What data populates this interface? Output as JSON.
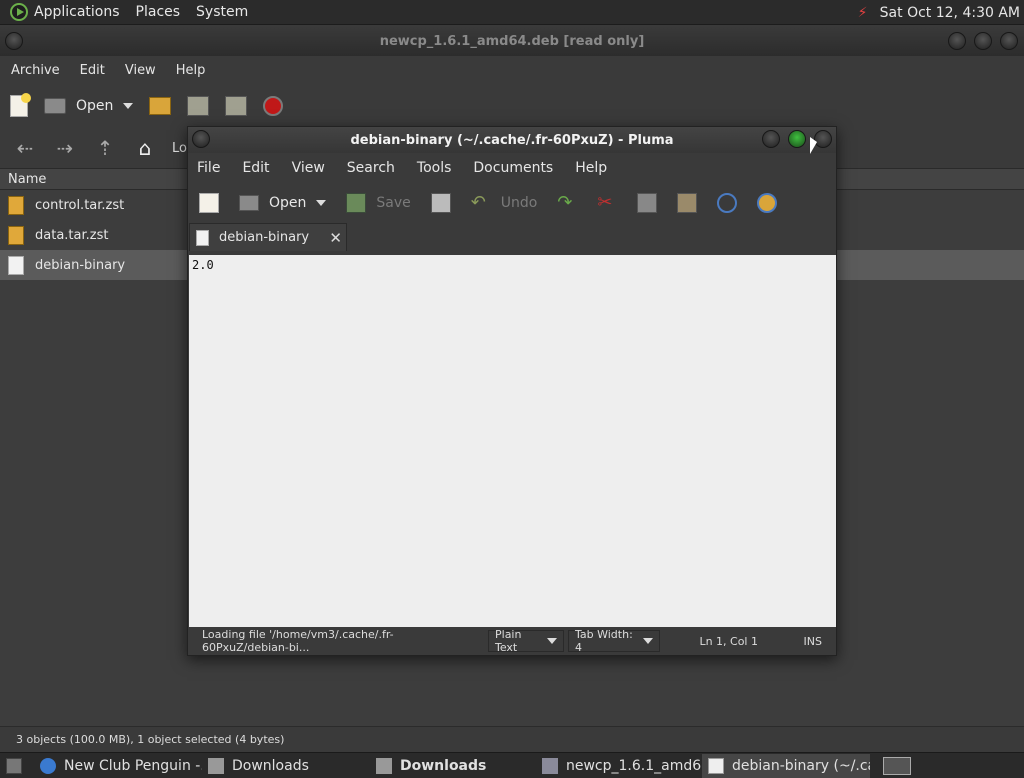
{
  "top_panel": {
    "menus": [
      "Applications",
      "Places",
      "System"
    ],
    "clock": "Sat Oct 12,  4:30 AM"
  },
  "archive": {
    "title": "newcp_1.6.1_amd64.deb [read only]",
    "menus": [
      "Archive",
      "Edit",
      "View",
      "Help"
    ],
    "toolbar": {
      "open_label": "Open"
    },
    "location_label": "Lo",
    "column_name": "Name",
    "files": [
      {
        "name": "control.tar.zst",
        "icon": "archive-icon"
      },
      {
        "name": "data.tar.zst",
        "icon": "archive-icon"
      },
      {
        "name": "debian-binary",
        "icon": "document-icon"
      }
    ],
    "status": "3 objects (100.0 MB), 1 object selected (4 bytes)"
  },
  "pluma": {
    "title": "debian-binary (~/.cache/.fr-60PxuZ) - Pluma",
    "menus": [
      "File",
      "Edit",
      "View",
      "Search",
      "Tools",
      "Documents",
      "Help"
    ],
    "toolbar": {
      "open": "Open",
      "save": "Save",
      "undo": "Undo"
    },
    "tab": "debian-binary",
    "content": "2.0",
    "status": {
      "message": "Loading file '/home/vm3/.cache/.fr-60PxuZ/debian-bi...",
      "syntax": "Plain Text",
      "tab_width": "Tab Width:  4",
      "position": "Ln 1, Col 1",
      "mode": "INS"
    }
  },
  "taskbar": {
    "tasks": [
      {
        "label": "New Club Penguin -...",
        "active": false,
        "bold": false
      },
      {
        "label": "Downloads",
        "active": false,
        "bold": false
      },
      {
        "label": "Downloads",
        "active": false,
        "bold": true
      },
      {
        "label": "newcp_1.6.1_amd6...",
        "active": false,
        "bold": false
      },
      {
        "label": "debian-binary (~/.ca...",
        "active": true,
        "bold": false
      }
    ]
  }
}
